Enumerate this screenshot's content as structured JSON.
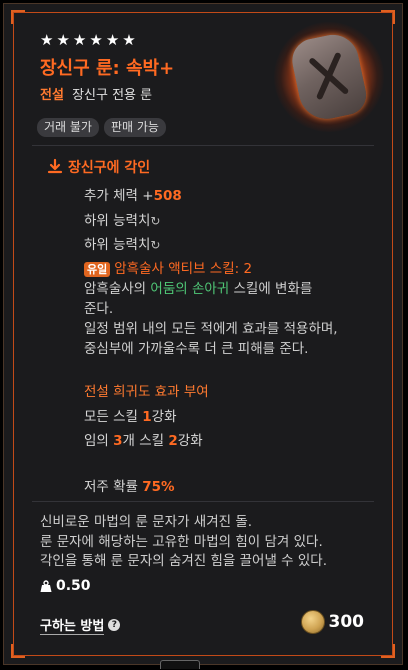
{
  "item": {
    "stars": 6,
    "title": "장신구 룬: 속박+",
    "grade_label": "전설",
    "type_label": "장신구 전용 룬",
    "tags": [
      "거래 불가",
      "판매 가능"
    ]
  },
  "engrave": {
    "header": "장신구에 각인",
    "stat_label": "추가 체력 +",
    "stat_value": "508",
    "sub_option_1": "하위 능력치",
    "sub_option_2": "하위 능력치",
    "unique_badge": "유일",
    "unique_skill": "암흑술사 액티브 스킬: 2",
    "desc_part1": "암흑술사의 ",
    "desc_highlight": "어둠의 손아귀",
    "desc_part2": " 스킬에 변화를",
    "desc_line2": "준다.",
    "desc_line3": "일정 범위 내의 모든 적에게 효과를 적용하며,",
    "desc_line4": "중심부에 가까울수록 더 큰 피해를 준다.",
    "legend_header": "전설 희귀도 효과 부여",
    "all_skill_label": "모든 스킬 ",
    "all_skill_value": "1",
    "all_skill_suffix": "강화",
    "random_prefix": "임의 ",
    "random_count": "3",
    "random_mid": "개 스킬 ",
    "random_value": "2",
    "random_suffix": "강화",
    "curse_label": "저주 확률 ",
    "curse_value": "75%"
  },
  "flavor": {
    "line1": "신비로운 마법의 룬 문자가 새겨진 돌.",
    "line2": "룬 문자에 해당하는 고유한 마법의 힘이 담겨 있다.",
    "line3": "각인을 통해 룬 문자의 숨겨진 힘을 끌어낼 수 있다."
  },
  "weight": "0.50",
  "how_to_get": "구하는 방법",
  "price": "300",
  "colors": {
    "accent": "#ff6a22",
    "highlight_green": "#4fc776",
    "frame": "#c24a18"
  },
  "icons": [
    "star-icon",
    "rune-stone-icon",
    "download-icon",
    "refresh-icon",
    "weight-icon",
    "help-icon",
    "gold-coin-icon"
  ]
}
